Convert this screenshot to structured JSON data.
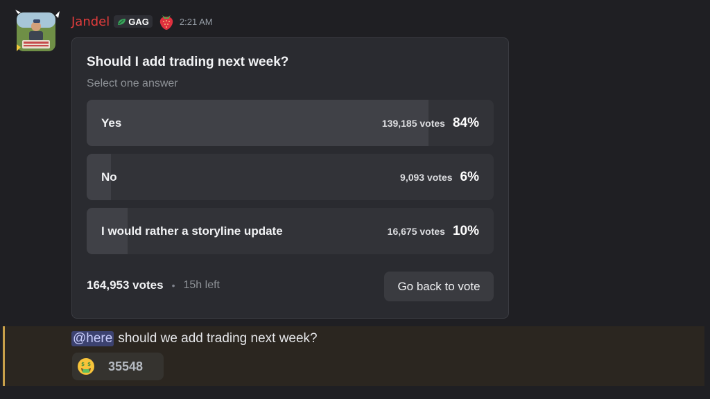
{
  "author": {
    "name": "Jandel",
    "tag": "GAG",
    "timestamp": "2:21 AM",
    "badge_icon": "strawberry-icon",
    "tag_icon": "leaf-icon",
    "name_color": "#e13c3c"
  },
  "poll": {
    "question": "Should I add trading next week?",
    "hint": "Select one answer",
    "options": [
      {
        "label": "Yes",
        "votes": "139,185 votes",
        "percent": "84%",
        "share": 0.84
      },
      {
        "label": "No",
        "votes": "9,093 votes",
        "percent": "6%",
        "share": 0.06
      },
      {
        "label": "I would rather a storyline update",
        "votes": "16,675 votes",
        "percent": "10%",
        "share": 0.1
      }
    ],
    "total_votes": "164,953 votes",
    "separator": "•",
    "time_left": "15h left",
    "vote_button": "Go back to vote"
  },
  "message": {
    "mention": "@here",
    "text": "should we add trading next week?"
  },
  "reaction": {
    "emoji": "money-mouth-face-icon",
    "count": "35548"
  },
  "colors": {
    "background": "#1f1f23",
    "mention_background": "#3c4270",
    "highlight_bar": "#c8a04a"
  }
}
